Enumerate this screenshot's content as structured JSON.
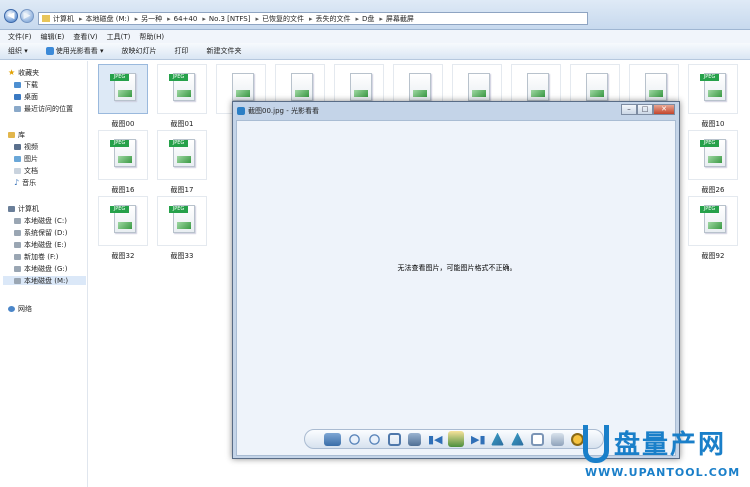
{
  "explorer": {
    "address_crumbs": [
      "计算机",
      "本地磁盘 (M:)",
      "另一种",
      "64+40",
      "No.3 [NTFS]",
      "已恢复的文件",
      "丢失的文件",
      "D盘",
      "屏幕截屏"
    ],
    "menu": [
      "文件(F)",
      "编辑(E)",
      "查看(V)",
      "工具(T)",
      "帮助(H)"
    ],
    "toolbar": {
      "organize": "组织 ▾",
      "open_with": "使用光影看看 ▾",
      "slideshow": "放映幻灯片",
      "print": "打印",
      "new_folder": "新建文件夹"
    },
    "sidebar": {
      "favorites": "收藏夹",
      "downloads": "下载",
      "desktop": "桌面",
      "recent": "最近访问的位置",
      "libraries": "库",
      "videos": "视频",
      "pictures": "图片",
      "documents": "文档",
      "music": "音乐",
      "computer": "计算机",
      "drive_c": "本地磁盘 (C:)",
      "drive_d": "系统保留 (D:)",
      "drive_e": "本地磁盘 (E:)",
      "drive_f": "新加卷 (F:)",
      "drive_g": "本地磁盘 (G:)",
      "drive_m": "本地磁盘 (M:)",
      "network": "网络"
    },
    "files": [
      {
        "name": "截图00",
        "label": "JPEG"
      },
      {
        "name": "截图01",
        "label": "JPEG"
      },
      {
        "name": "截图10",
        "label": "JPEG"
      },
      {
        "name": "截图16",
        "label": "JPEG"
      },
      {
        "name": "截图17",
        "label": "JPEG"
      },
      {
        "name": "截图26",
        "label": "JPEG"
      },
      {
        "name": "截图32",
        "label": "JPEG"
      },
      {
        "name": "截图33",
        "label": "JPEG"
      },
      {
        "name": "截图92",
        "label": "JPEG"
      }
    ]
  },
  "viewer": {
    "title": "截图00.jpg - 光影看看",
    "message": "无法查看图片，可能图片格式不正确。"
  },
  "watermark": {
    "text": "盘量产网",
    "url": "WWW.UPANTOOL.COM"
  },
  "colors": {
    "accent": "#1a7fc9",
    "jpeg_badge": "#26a14a"
  }
}
